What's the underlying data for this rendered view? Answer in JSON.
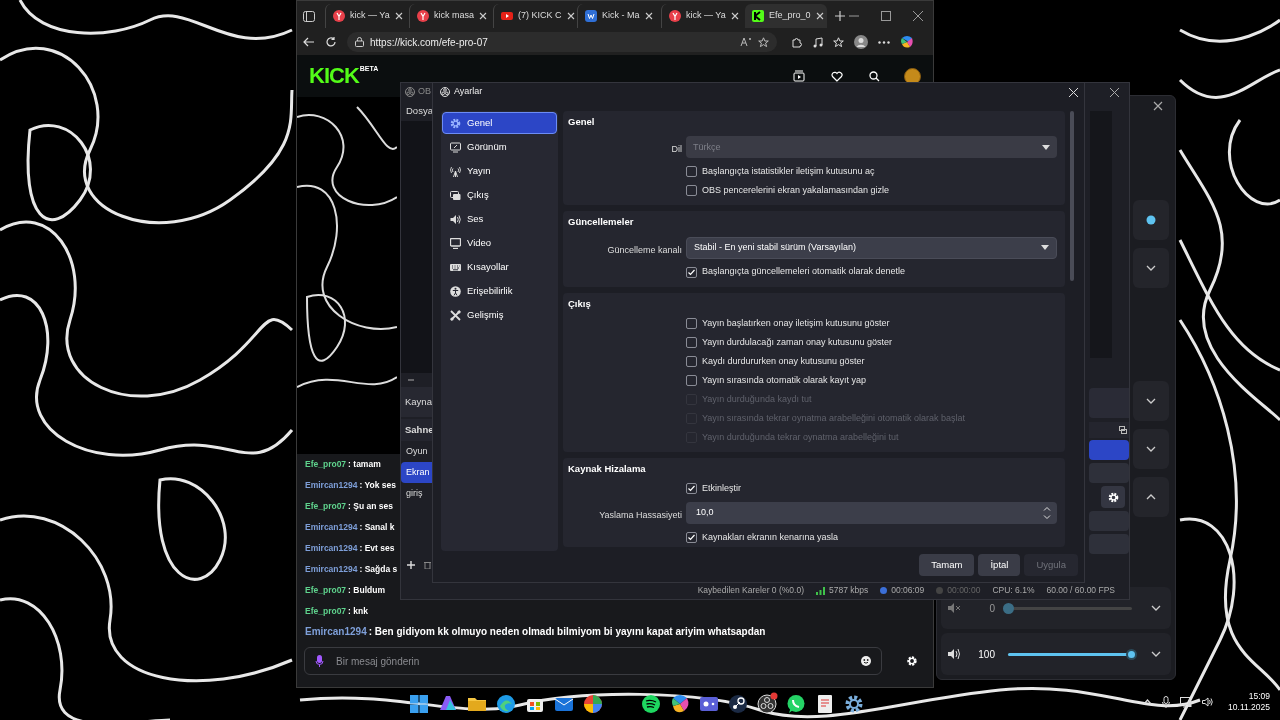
{
  "browser": {
    "tabs": [
      {
        "label": "kick — Ya",
        "selected": false
      },
      {
        "label": "kick masa",
        "selected": false
      },
      {
        "label": "(7) KICK C",
        "selected": false
      },
      {
        "label": "Kick - Ma",
        "selected": false
      },
      {
        "label": "kick — Ya",
        "selected": false
      },
      {
        "label": "Efe_pro_0",
        "selected": true
      }
    ],
    "url": "https://kick.com/efe-pro-07"
  },
  "kick": {
    "logo": "KICK",
    "logo_badge": "BETA",
    "chat": [
      {
        "user": "Efe_pro07",
        "color": "#5fd38d",
        "message": ": tamam"
      },
      {
        "user": "Emircan1294",
        "color": "#7e9fd9",
        "message": ": Yok ses"
      },
      {
        "user": "Efe_pro07",
        "color": "#5fd38d",
        "message": ": Şu an ses"
      },
      {
        "user": "Emircan1294",
        "color": "#7e9fd9",
        "message": ": Sanal k"
      },
      {
        "user": "Emircan1294",
        "color": "#7e9fd9",
        "message": ": Evt ses"
      },
      {
        "user": "Emircan1294",
        "color": "#7e9fd9",
        "message": ": Sağda s"
      },
      {
        "user": "Efe_pro07",
        "color": "#5fd38d",
        "message": ": Buldum"
      },
      {
        "user": "Efe_pro07",
        "color": "#5fd38d",
        "message": ": knk"
      },
      {
        "user": "Emircan1294",
        "color": "#7e9fd9",
        "message": ": Ben gidiyom kk olmuyo neden olmadı bilmiyom bi yayını kapat ariyim whatsapdan"
      }
    ],
    "message_placeholder": "Bir mesaj gönderin"
  },
  "obs": {
    "title": "OB",
    "menu": "Dosya",
    "sources_header": "Kayna",
    "scenes_header": "Sahne",
    "scenes": [
      {
        "label": "Oyun",
        "selected": false
      },
      {
        "label": "Ekran",
        "selected": true
      },
      {
        "label": "giriş",
        "selected": false
      }
    ],
    "status": [
      "Kaybedilen Kareler 0 (%0.0)",
      "5787 kbps",
      "00:06:09",
      "00:00:00",
      "CPU: 6.1%",
      "60.00 / 60.00 FPS"
    ]
  },
  "settings": {
    "title": "Ayarlar",
    "nav": [
      {
        "label": "Genel",
        "selected": true
      },
      {
        "label": "Görünüm",
        "selected": false
      },
      {
        "label": "Yayın",
        "selected": false
      },
      {
        "label": "Çıkış",
        "selected": false
      },
      {
        "label": "Ses",
        "selected": false
      },
      {
        "label": "Video",
        "selected": false
      },
      {
        "label": "Kısayollar",
        "selected": false
      },
      {
        "label": "Erişebilirlik",
        "selected": false
      },
      {
        "label": "Gelişmiş",
        "selected": false
      }
    ],
    "sections": [
      {
        "title": "Genel",
        "rows": [
          {
            "kind": "select",
            "label": "Dil",
            "value": "Türkçe",
            "disabled": true
          },
          {
            "kind": "checkbox",
            "label": "Başlangıçta istatistikler iletişim kutusunu aç",
            "checked": false,
            "disabled": false
          },
          {
            "kind": "checkbox",
            "label": "OBS pencerelerini ekran yakalamasından gizle",
            "checked": false,
            "disabled": false
          }
        ]
      },
      {
        "title": "Güncellemeler",
        "rows": [
          {
            "kind": "select",
            "label": "Güncelleme kanalı",
            "value": "Stabil - En yeni stabil sürüm (Varsayılan)",
            "disabled": false
          },
          {
            "kind": "checkbox",
            "label": "Başlangıçta güncellemeleri otomatik olarak denetle",
            "checked": true,
            "disabled": false
          }
        ]
      },
      {
        "title": "Çıkış",
        "rows": [
          {
            "kind": "checkbox",
            "label": "Yayın başlatırken onay iletişim kutusunu göster",
            "checked": false,
            "disabled": false
          },
          {
            "kind": "checkbox",
            "label": "Yayın durdulacağı zaman onay kutusunu göster",
            "checked": false,
            "disabled": false
          },
          {
            "kind": "checkbox",
            "label": "Kaydı durdururken onay kutusunu göster",
            "checked": false,
            "disabled": false
          },
          {
            "kind": "checkbox",
            "label": "Yayın sırasında otomatik olarak kayıt yap",
            "checked": false,
            "disabled": false
          },
          {
            "kind": "checkbox",
            "label": "Yayın durduğunda kaydı tut",
            "checked": false,
            "disabled": true
          },
          {
            "kind": "checkbox",
            "label": "Yayın sırasında tekrar oynatma arabelleğini otomatik olarak başlat",
            "checked": false,
            "disabled": true
          },
          {
            "kind": "checkbox",
            "label": "Yayın durduğunda tekrar oynatma arabelleğini tut",
            "checked": false,
            "disabled": true
          }
        ]
      },
      {
        "title": "Kaynak Hizalama",
        "rows": [
          {
            "kind": "checkbox",
            "label": "Etkinleştir",
            "checked": true,
            "disabled": false
          },
          {
            "kind": "spin",
            "label": "Yaslama Hassasiyeti",
            "value": "10,0"
          },
          {
            "kind": "checkbox",
            "label": "Kaynakları ekranın kenarına yasla",
            "checked": true,
            "disabled": false
          }
        ]
      }
    ],
    "buttons": [
      {
        "label": "Tamam",
        "disabled": false
      },
      {
        "label": "İptal",
        "disabled": false
      },
      {
        "label": "Uygula",
        "disabled": true
      }
    ]
  },
  "mixer": {
    "channels": [
      {
        "muted": true,
        "reading": "0",
        "level": 0
      },
      {
        "muted": false,
        "reading": "100",
        "level": 1
      }
    ]
  },
  "taskbar": {
    "time": "15:09",
    "date": "10.11.2025"
  }
}
